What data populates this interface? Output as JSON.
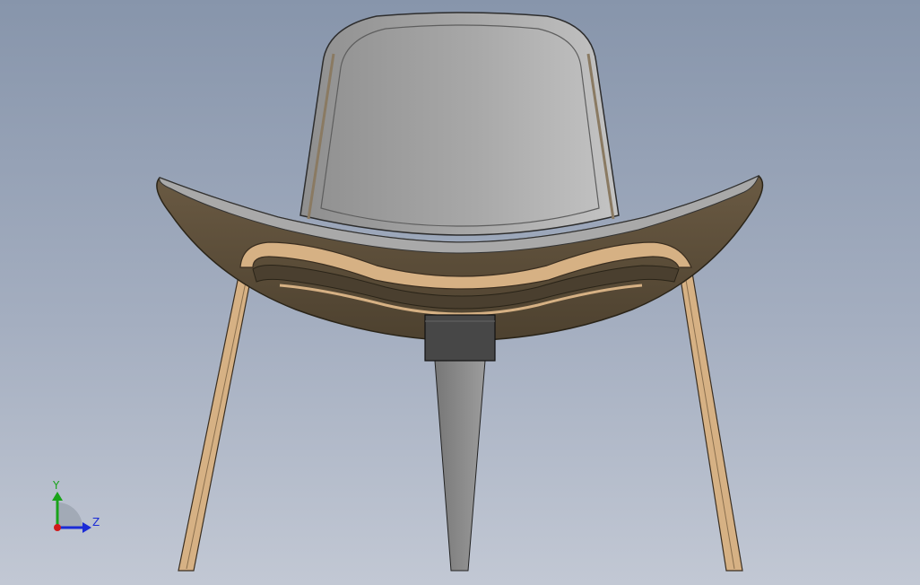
{
  "viewport": {
    "background_top": "#8795ab",
    "background_bottom": "#c2c8d4"
  },
  "model": {
    "name": "shell-chair",
    "shell_color": "#5a4c38",
    "back_color": "#a9a9a9",
    "leg_color": "#d6b184",
    "hub_color": "#474747",
    "rear_leg_color": "#8c8c8c"
  },
  "triad": {
    "y_label": "Y",
    "z_label": "Z",
    "y_color": "#19a319",
    "z_color": "#1a2bd6",
    "x_color": "#d11a1a"
  }
}
